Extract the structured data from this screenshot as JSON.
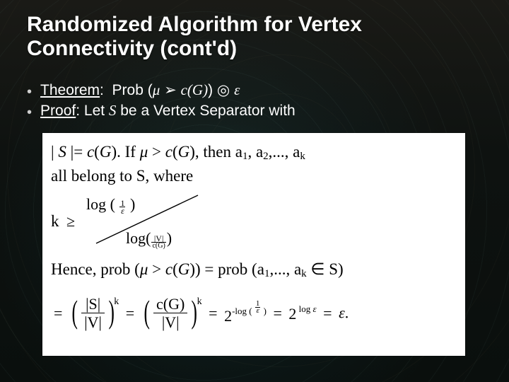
{
  "title": "Randomized Algorithm for Vertex Connectivity (cont'd)",
  "bullet1": {
    "label": "Theorem",
    "pre": ":  Prob (",
    "mu": "μ",
    "op1": " ➢ ",
    "cg_open": "c(",
    "cg_var": "G",
    "cg_close": ")",
    "close": ") ",
    "op2": "◎ ",
    "eps": "ε"
  },
  "bullet2": {
    "label": "Proof",
    "pre": ": Let ",
    "S": "S",
    "post": " be a Vertex Separator with"
  },
  "formula": {
    "line1_a": "| ",
    "line1_S": "S",
    "line1_b": " |= ",
    "line1_c": "c",
    "line1_d": "(",
    "line1_G": "G",
    "line1_e": ").  If  ",
    "line1_mu": "μ",
    "line1_f": " > ",
    "line1_g": "(",
    "line1_h": "), then  a",
    "line1_s1": "1",
    "line1_i": ", a",
    "line1_s2": "2",
    "line1_j": ",..., a",
    "line1_sk": "k",
    "line2": "all belong to S, where",
    "k": "k",
    "ge": "≥",
    "numA_a": "log ( ",
    "numA_num1": "1",
    "numA_den1": "ε",
    "numA_b": " )",
    "denA_a": "log(",
    "denA_num2": "|V|",
    "denA_den2": "c(G)",
    "denA_b": ")",
    "hence_a": "Hence, prob (",
    "hence_mu": "μ",
    "hence_b": " > ",
    "hence_c": "c",
    "hence_d": "(",
    "hence_G": "G",
    "hence_e": ")) = prob (a",
    "hence_s1": "1",
    "hence_f": ",..., a",
    "hence_sk": "k",
    "hence_g": " ∈ S)",
    "eq": "=",
    "frac1_num": "|S|",
    "frac1_den": "|V|",
    "frac2_num": "c(G)",
    "frac2_den": "|V|",
    "two": "2",
    "exp1_a": "-log ( ",
    "exp1_n": "1",
    "exp1_d": "ε",
    "exp1_b": " )",
    "exp2_a": " log ",
    "exp2_eps": "ε",
    "final_eps": "ε",
    "period": "."
  }
}
